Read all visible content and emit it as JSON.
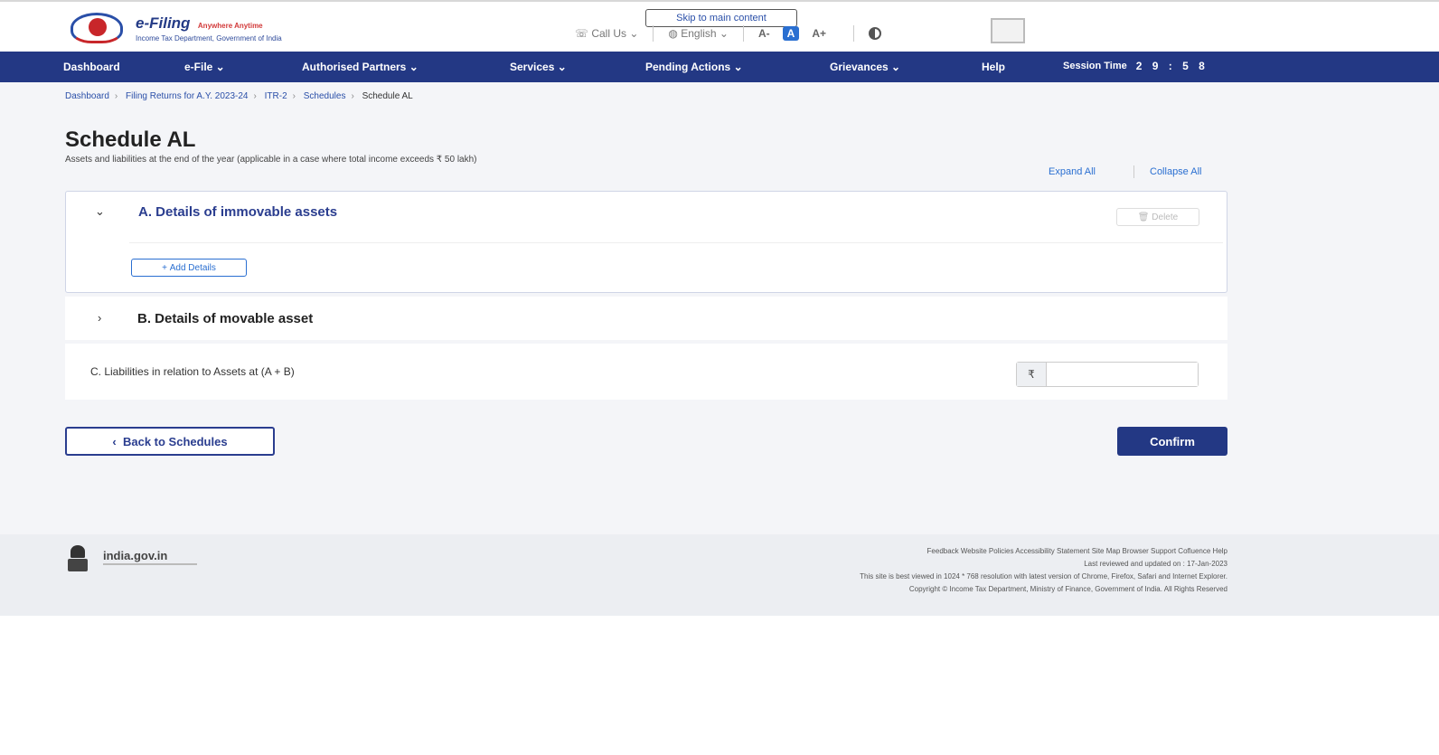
{
  "header": {
    "logo_title": "e-Filing",
    "logo_tag": "Anywhere Anytime",
    "logo_subtitle": "Income Tax Department, Government of India",
    "skip_link": "Skip to main content",
    "call_us": "Call Us",
    "language": "English",
    "font_decrease": "A-",
    "font_normal": "A",
    "font_increase": "A+"
  },
  "nav": {
    "items": [
      "Dashboard",
      "e-File",
      "Authorised Partners",
      "Services",
      "Pending Actions",
      "Grievances",
      "Help"
    ],
    "session_label": "Session Time",
    "session_time": "2 9 : 5 8"
  },
  "breadcrumb": [
    "Dashboard",
    "Filing Returns for A.Y. 2023-24",
    "ITR-2",
    "Schedules",
    "Schedule AL"
  ],
  "page": {
    "title": "Schedule AL",
    "subtitle": "Assets and liabilities at the end of the year (applicable in a case where total income exceeds ₹ 50 lakh)",
    "expand_all": "Expand All",
    "collapse_all": "Collapse All"
  },
  "sections": {
    "a_title": "A. Details of immovable assets",
    "delete_label": "Delete",
    "add_details_label": "Add Details",
    "b_title": "B. Details of movable asset",
    "c_label": "C. Liabilities in relation to Assets at (A + B)",
    "currency_symbol": "₹",
    "c_value": ""
  },
  "actions": {
    "back_label": "Back to Schedules",
    "confirm_label": "Confirm"
  },
  "footer": {
    "site_name": "india.gov.in",
    "links": "Feedback Website Policies Accessibility Statement Site Map Browser Support Cofluence Help",
    "last_reviewed": "Last reviewed and updated on : 17-Jan-2023",
    "resolution_note": "This site is best viewed in 1024 * 768 resolution with latest version of Chrome, Firefox, Safari and Internet Explorer.",
    "copyright": "Copyright © Income Tax Department, Ministry of Finance, Government of India. All Rights Reserved"
  },
  "colors": {
    "brand_navy": "#233884",
    "link_blue": "#2a6fd1",
    "page_bg": "#f4f5f8"
  }
}
